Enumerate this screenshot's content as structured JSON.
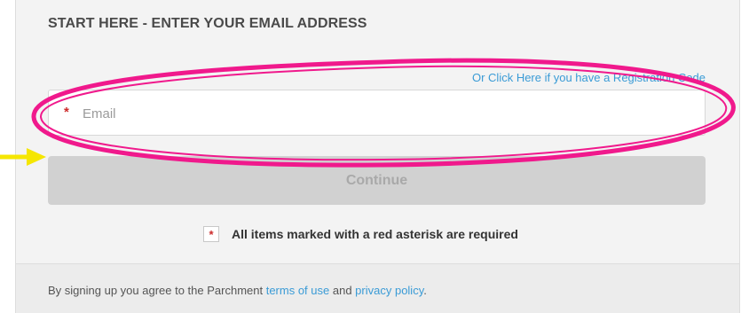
{
  "section": {
    "heading": "START HERE - ENTER YOUR EMAIL ADDRESS",
    "registration_link": "Or Click Here if you have a Registration Code"
  },
  "email_field": {
    "required_marker": "*",
    "placeholder": "Email",
    "value": ""
  },
  "continue_button": {
    "label": "Continue"
  },
  "required_note": {
    "marker": "*",
    "text": "All items marked with a red asterisk are required"
  },
  "footer": {
    "prefix": "By signing up you agree to the Parchment ",
    "terms_link": "terms of use",
    "middle": " and ",
    "privacy_link": "privacy policy",
    "suffix": "."
  },
  "colors": {
    "link": "#3a9bd6",
    "required": "#cc2a2a",
    "annotation_ellipse": "#f0198c",
    "annotation_arrow": "#f5e600"
  }
}
